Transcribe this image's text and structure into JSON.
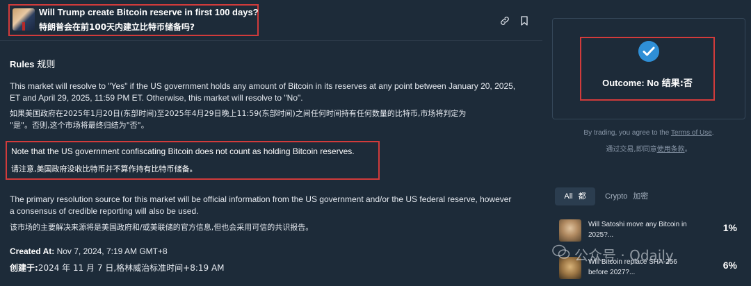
{
  "header": {
    "title_en": "Will Trump create Bitcoin reserve in first 100 days?",
    "title_zh": "特朗普会在前100天内建立比特币储备吗?"
  },
  "rules": {
    "heading": "Rules",
    "heading_zh": "规则",
    "p1_line1": "This market will resolve to \"Yes\" if the US government holds any amount of Bitcoin in its reserves at any point between January 20, 2025,",
    "p1_line2": "ET and April 29, 2025, 11:59 PM ET. Otherwise, this market will resolve to \"No\".",
    "p1_zh_line1": "如果美国政府在2025年1月20日(东部时间)至2025年4月29日晚上11:59(东部时间)之间任何时间持有任何数量的比特币,市场将判定为",
    "p1_zh_line2": "\"是\"。否则,这个市场将最终归结为\"否\"。",
    "note_en": "Note that the US government confiscating Bitcoin does not count as holding Bitcoin reserves.",
    "note_zh": "请注意,美国政府没收比特币并不算作持有比特币储备。",
    "p2_line1": "The primary resolution source for this market will be official information from the US government and/or the US federal reserve, however",
    "p2_line2": "a consensus of credible reporting will also be used.",
    "p2_zh": "该市场的主要解决来源将是美国政府和/或美联储的官方信息,但也会采用可信的共识报告。",
    "created_label": "Created At:",
    "created_value": "Nov 7, 2024, 7:19 AM GMT+8",
    "created_zh_label": "创建于:",
    "created_zh_value": "2024 年 11 月 7 日,格林威治标准时间+8:19 AM"
  },
  "outcome": {
    "label": "Outcome: No",
    "label_zh": "结果:否",
    "accent": "#2f8fd6"
  },
  "terms": {
    "prefix": "By trading, you agree to the ",
    "link": "Terms of Use",
    "suffix": ".",
    "zh_prefix": "通过交易,即同意",
    "zh_link": "使用条款",
    "zh_suffix": "。"
  },
  "tabs": {
    "all": "All",
    "all_zh": "都",
    "crypto": "Crypto",
    "crypto_zh": "加密"
  },
  "markets": [
    {
      "title_line1": "Will Satoshi move any Bitcoin in",
      "title_line2": "2025?...",
      "pct": "1%"
    },
    {
      "title_line1": "Will Bitcoin replace SHA-256",
      "title_line2": "before 2027?...",
      "pct": "6%"
    }
  ],
  "watermark": "公众号 · Odaily",
  "icons": [
    "link-icon",
    "bookmark-icon",
    "check-circle-icon"
  ]
}
